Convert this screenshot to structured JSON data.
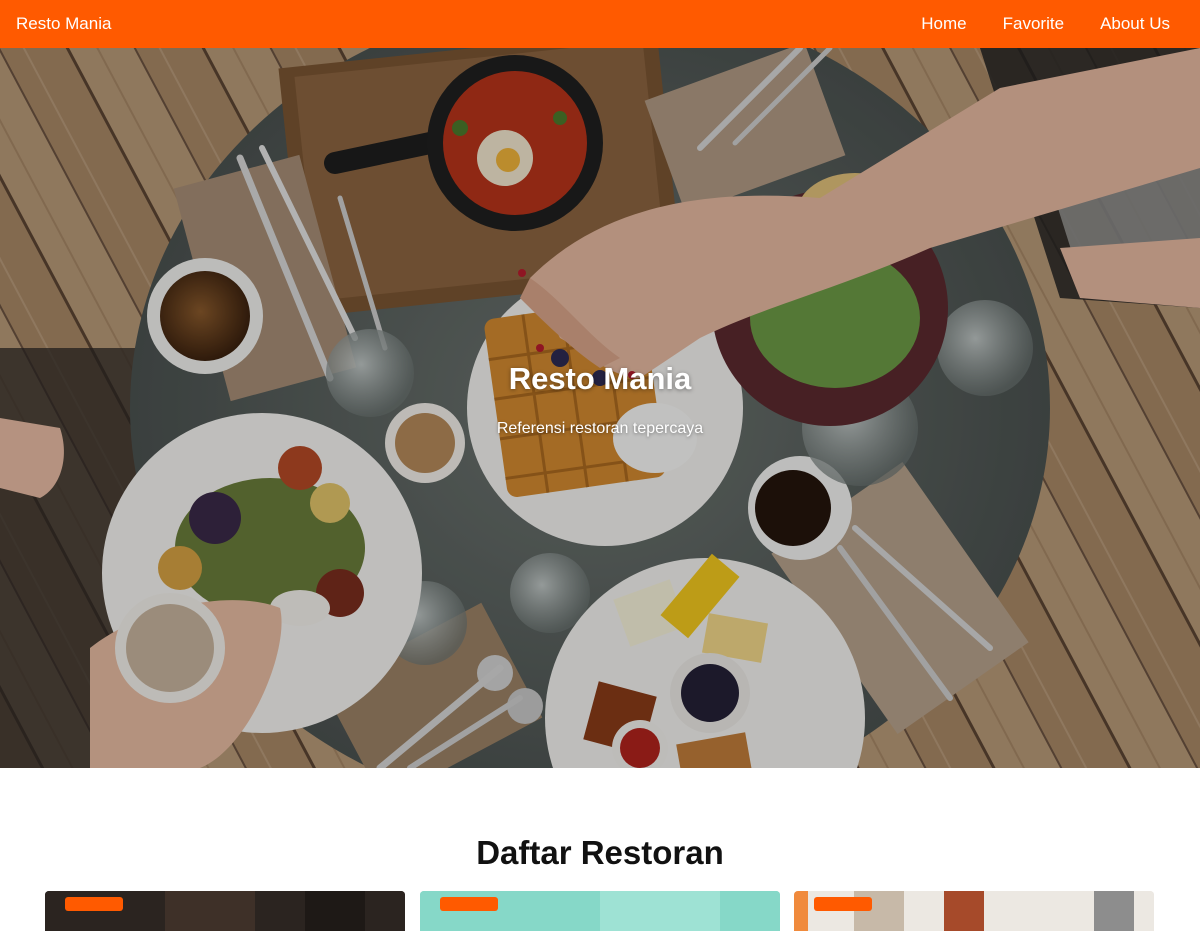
{
  "navbar": {
    "brand": "Resto Mania",
    "links": [
      {
        "label": "Home"
      },
      {
        "label": "Favorite"
      },
      {
        "label": "About Us"
      }
    ],
    "background_color": "#ff5a00"
  },
  "hero": {
    "title": "Resto Mania",
    "subtitle": "Referensi restoran tepercaya"
  },
  "restaurant_list": {
    "heading": "Daftar Restoran",
    "cards": [
      {
        "image": "restaurant-photo-dark-interior"
      },
      {
        "image": "restaurant-photo-mint-interior"
      },
      {
        "image": "restaurant-photo-light-interior"
      }
    ]
  }
}
